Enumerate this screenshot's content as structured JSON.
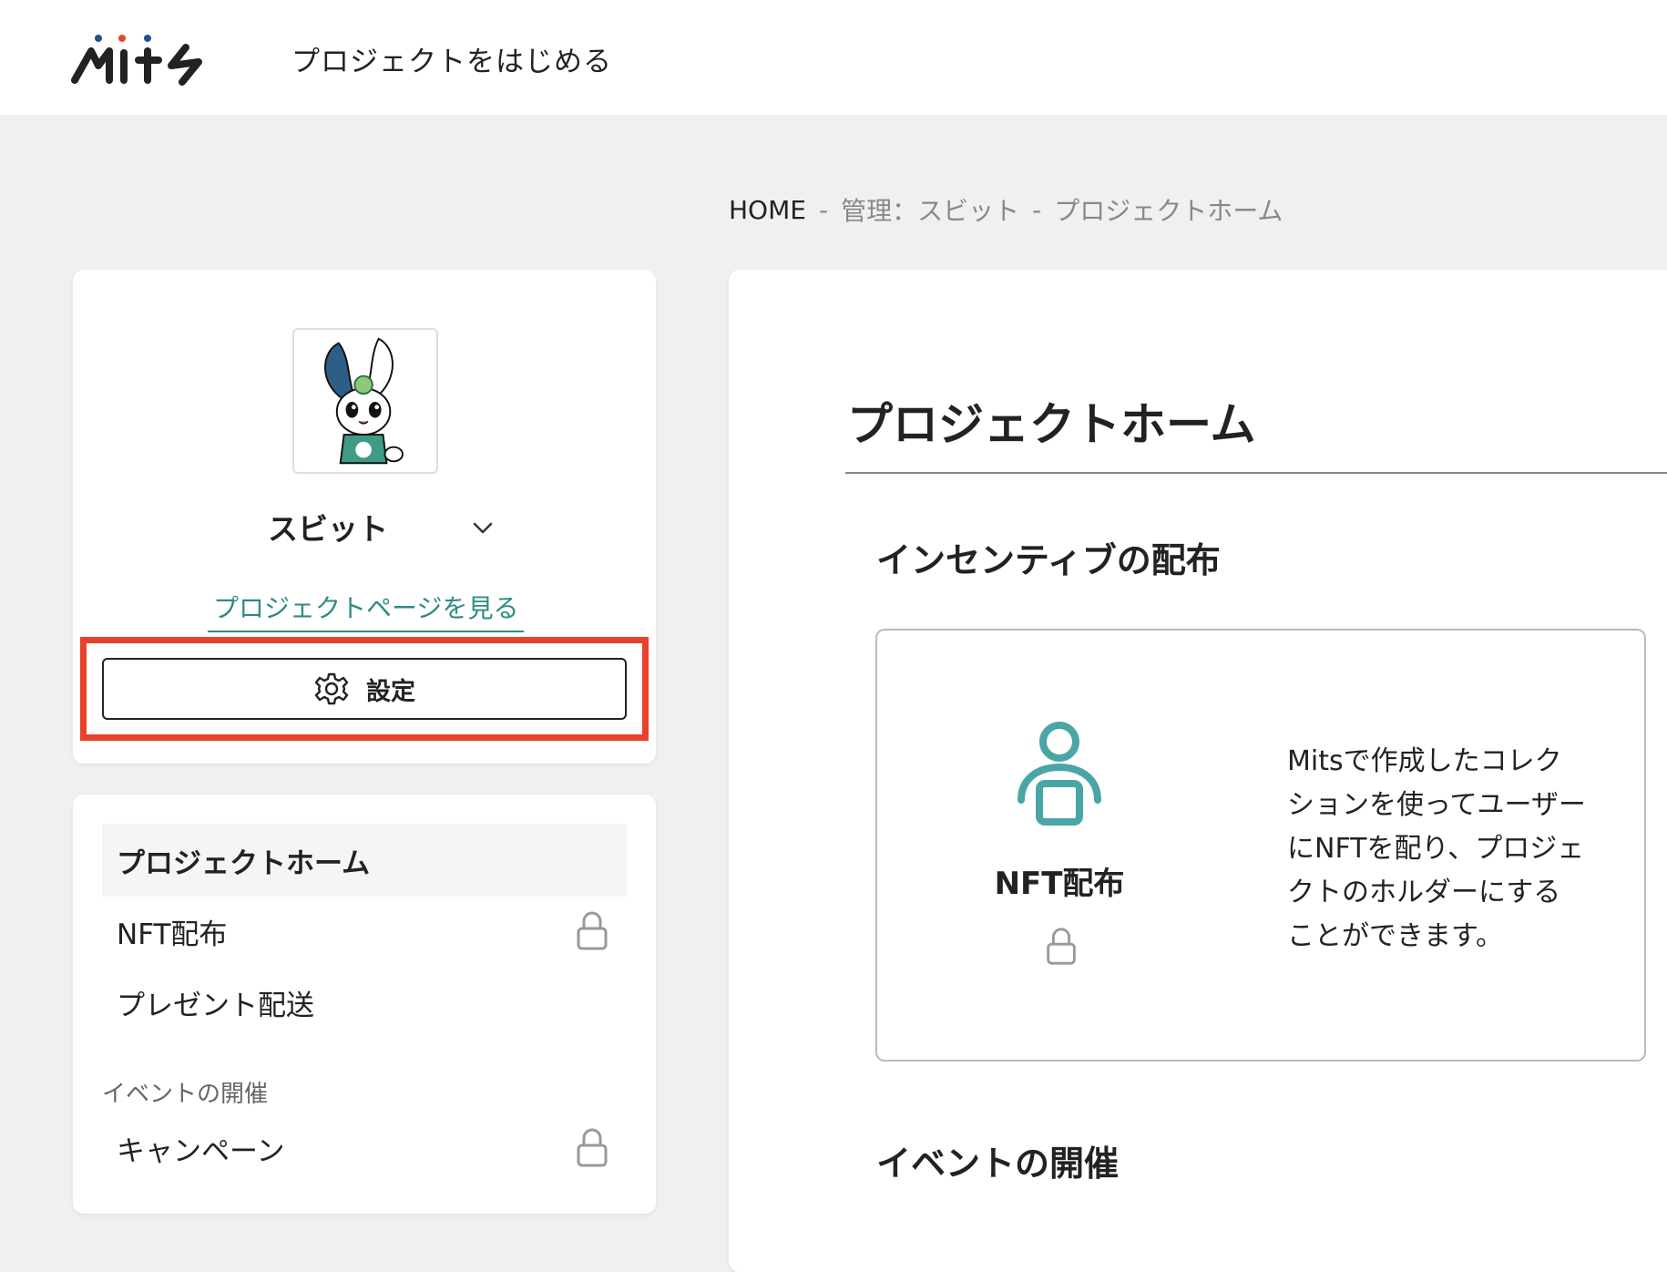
{
  "header": {
    "logo_text": "Mits",
    "title": "プロジェクトをはじめる"
  },
  "breadcrumb": {
    "home": "HOME",
    "sep1": "-",
    "manage": "管理：スビット",
    "sep2": "-",
    "current": "プロジェクトホーム"
  },
  "profile": {
    "project_name": "スビット",
    "view_page_link": "プロジェクトページを見る",
    "settings_label": "設定"
  },
  "nav": {
    "items": [
      {
        "label": "プロジェクトホーム",
        "active": true,
        "locked": false
      },
      {
        "label": "NFT配布",
        "active": false,
        "locked": true
      },
      {
        "label": "プレゼント配送",
        "active": false,
        "locked": false
      }
    ],
    "section_label": "イベントの開催",
    "section_items": [
      {
        "label": "キャンペーン",
        "locked": true
      }
    ]
  },
  "main": {
    "title": "プロジェクトホーム",
    "section1_title": "インセンティブの配布",
    "feature": {
      "label": "NFT配布",
      "icon": "user-icon",
      "description": "Mitsで作成したコレクションを使ってユーザーにNFTを配り、プロジェクトのホルダーにすることができます。",
      "locked": true
    },
    "section2_title": "イベントの開催"
  },
  "colors": {
    "accent": "#2f8a86",
    "highlight": "#e8422b",
    "icon_teal": "#4aa6a6"
  }
}
